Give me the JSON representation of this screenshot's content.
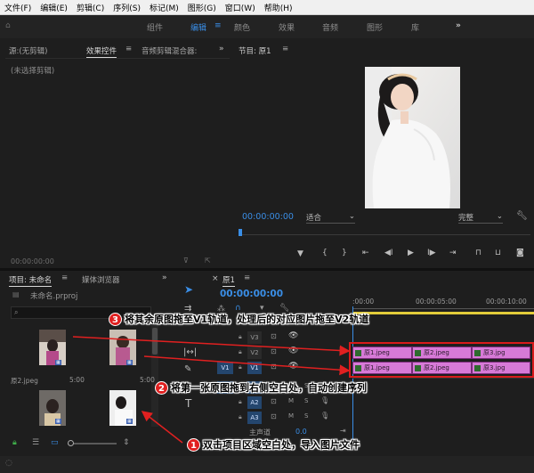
{
  "menu": [
    "文件(F)",
    "编辑(E)",
    "剪辑(C)",
    "序列(S)",
    "标记(M)",
    "图形(G)",
    "窗口(W)",
    "帮助(H)"
  ],
  "workspaces": [
    "组件",
    "编辑",
    "颜色",
    "效果",
    "音频",
    "图形",
    "库"
  ],
  "workspace_more": "»",
  "source_panel": {
    "tabs": [
      "源:(无剪辑)",
      "效果控件",
      "音频剪辑混合器:"
    ],
    "more": "»",
    "empty_text": "(未选择剪辑)",
    "timecode": "00:00:00:00"
  },
  "program_monitor": {
    "title": "节目: 原1",
    "timecode": "00:00:00:00",
    "fit": "适合",
    "quality": "完整"
  },
  "project_panel": {
    "tabs": [
      "项目: 未命名",
      "媒体浏览器"
    ],
    "more": "»",
    "project_file": "未命名.prproj",
    "search_icon": "search-icon",
    "items": [
      {
        "name": "原2.jpeg",
        "duration": "5:00"
      },
      {
        "name": "",
        "duration": "5:00"
      },
      {
        "name": "",
        "duration": ""
      },
      {
        "name": "",
        "duration": ""
      }
    ]
  },
  "timeline": {
    "tab": "原1",
    "timecode": "00:00:00:00",
    "ruler": [
      ":00:00",
      "00:00:05:00",
      "00:00:10:00"
    ],
    "tracks": [
      {
        "label": "V3"
      },
      {
        "label": "V2"
      },
      {
        "label": "V1"
      },
      {
        "label": "A1"
      },
      {
        "label": "A2"
      },
      {
        "label": "A3"
      }
    ],
    "source_labels": [
      "V1",
      "A1"
    ],
    "master_label": "主声道",
    "master_value": "0.0",
    "v2_clips": [
      "原1.jpeg",
      "原2.jpeg",
      "原3.jpg"
    ],
    "v1_clips": [
      "原1.jpeg",
      "原2.jpeg",
      "原3.jpg"
    ]
  },
  "annotations": [
    {
      "num": "3",
      "text": "将其余原图拖至V1轨道，处理后的对应图片拖至V2轨道"
    },
    {
      "num": "2",
      "text": "将第一张原图拖到右侧空白处，自动创建序列"
    },
    {
      "num": "1",
      "text": "双击项目区域空白处，导入图片文件"
    }
  ],
  "colors": {
    "accent": "#3a8ee6",
    "clip": "#d77ad7",
    "annotation_red": "#e02020",
    "playhead": "#3a8ee6"
  }
}
